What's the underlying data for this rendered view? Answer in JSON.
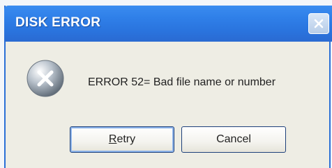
{
  "dialog": {
    "title": "DISK ERROR",
    "message": "ERROR  52= Bad file name or number",
    "icon": "error-x-icon",
    "buttons": {
      "retry_label": "Retry",
      "cancel_label": "Cancel"
    }
  },
  "colors": {
    "titlebar": "#2a74de",
    "frame": "#2a6fd6",
    "body": "#eeede4",
    "default_button_glow": "#8eb4ea"
  }
}
